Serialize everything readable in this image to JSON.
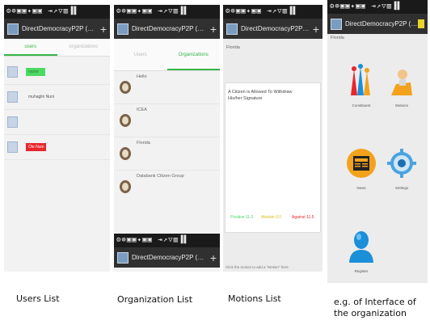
{
  "statusbar": "⚙⊕▣▣✦▣▣ ⇥↗▽▥▐▌",
  "app_title": "DirectDemocracyP2P (DDP...",
  "captions": {
    "users": "Users List",
    "orgs": "Organization List",
    "motions": "Motions List",
    "interface": "e.g. of Interface of the organization"
  },
  "users_panel": {
    "tabs": [
      "users",
      "organizations"
    ],
    "users": [
      {
        "name": "name",
        "highlight": "#4cd964"
      },
      {
        "name": "muhaglin Nuni",
        "highlight": ""
      },
      {
        "name": "",
        "highlight": ""
      },
      {
        "name": "Ole Nuni",
        "highlight": "#e8262c"
      }
    ]
  },
  "orgs_panel": {
    "tabs": [
      "Users",
      "Organizations"
    ],
    "orgs": [
      "Hello",
      "ICEA",
      "Florida",
      "Databank Citizen Group"
    ]
  },
  "motions_panel": {
    "breadcrumb": "Florida",
    "motion_title": "A Citizen is Allowed To Withdraw His/her Signature",
    "votes": [
      {
        "label": "Positive 11.0",
        "color": "#4cd964"
      },
      {
        "label": "Abstain 0.0",
        "color": "#e8d62c"
      },
      {
        "label": "Against 11.5",
        "color": "#e8262c"
      }
    ],
    "hint": "Click the motion to add a \"Motion\" here"
  },
  "interface_panel": {
    "breadcrumb": "Florida",
    "features": [
      "Constituent",
      "Motions",
      "News",
      "Settings",
      "Register"
    ]
  }
}
